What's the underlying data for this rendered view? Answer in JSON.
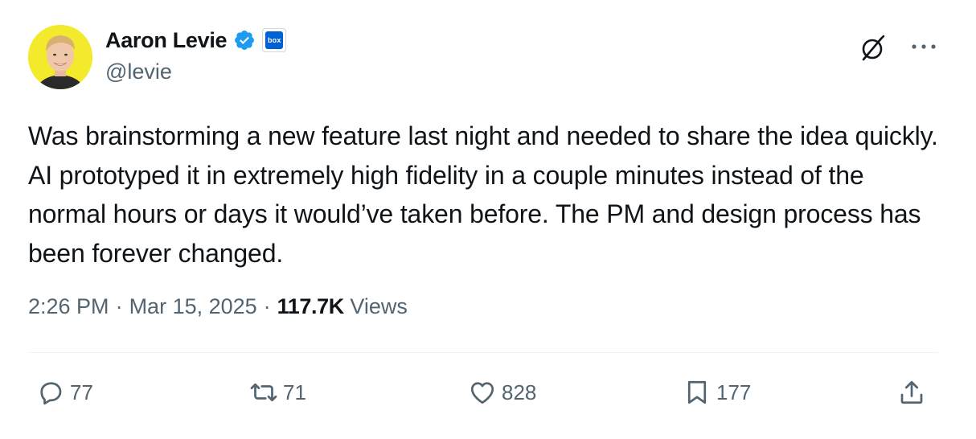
{
  "author": {
    "name": "Aaron Levie",
    "handle": "@levie",
    "verified": true,
    "affiliation_badge_text": "box",
    "avatar_background": "#f2ea2b"
  },
  "tweet": {
    "text": "Was brainstorming a new feature last night and needed to share the idea quickly. AI prototyped it in extremely high fidelity in a couple minutes instead of the normal hours or days it would’ve taken before. The PM and design process has been forever changed."
  },
  "meta": {
    "time": "2:26 PM",
    "separator": "·",
    "date": "Mar 15, 2025",
    "views_count": "117.7K",
    "views_label": "Views"
  },
  "actions": {
    "replies": "77",
    "reposts": "71",
    "likes": "828",
    "bookmarks": "177"
  },
  "icons": {
    "header": [
      "grok-icon",
      "more-icon"
    ],
    "actions": [
      "reply-icon",
      "repost-icon",
      "like-icon",
      "bookmark-icon",
      "share-icon"
    ]
  },
  "colors": {
    "text_primary": "#0f1419",
    "text_secondary": "#536471",
    "verified_blue": "#1d9bf0",
    "divider": "#eff3f4"
  }
}
